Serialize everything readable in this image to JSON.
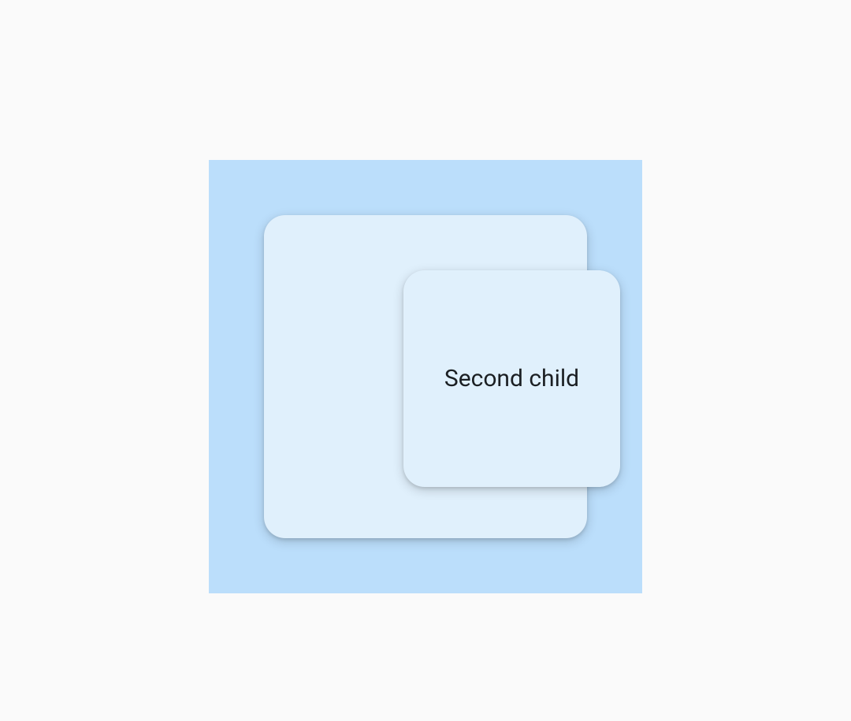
{
  "outer": {
    "first_child_label": "",
    "second_child_label": "Second child"
  }
}
